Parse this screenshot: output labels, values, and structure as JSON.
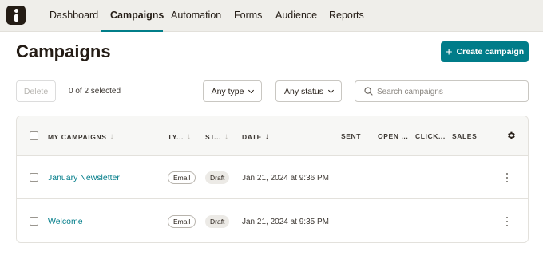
{
  "nav": {
    "items": [
      {
        "label": "Dashboard"
      },
      {
        "label": "Campaigns"
      },
      {
        "label": "Automation"
      },
      {
        "label": "Forms"
      },
      {
        "label": "Audience"
      },
      {
        "label": "Reports"
      }
    ],
    "active": "Campaigns",
    "logo_icon": "brand-logo-icon"
  },
  "header": {
    "title": "Campaigns",
    "create_button": {
      "label": "Create campaign",
      "icon": "plus-icon"
    }
  },
  "toolbar": {
    "delete_label": "Delete",
    "selected_text": "0 of 2 selected",
    "type_filter": "Any type",
    "status_filter": "Any status",
    "search_placeholder": "Search campaigns",
    "search_value": ""
  },
  "table": {
    "columns": [
      {
        "label": "MY CAMPAIGNS"
      },
      {
        "label": "TY..."
      },
      {
        "label": "ST..."
      },
      {
        "label": "DATE"
      },
      {
        "label": "SENT"
      },
      {
        "label": "OPEN ..."
      },
      {
        "label": "CLICK..."
      },
      {
        "label": "SALES"
      }
    ],
    "rows": [
      {
        "name": "January Newsletter",
        "type": "Email",
        "status": "Draft",
        "date": "Jan 21, 2024 at 9:36 PM"
      },
      {
        "name": "Welcome",
        "type": "Email",
        "status": "Draft",
        "date": "Jan 21, 2024 at 9:35 PM"
      }
    ]
  },
  "colors": {
    "accent": "#007c89",
    "nav_bg": "#efeeea",
    "text": "#241c15"
  }
}
